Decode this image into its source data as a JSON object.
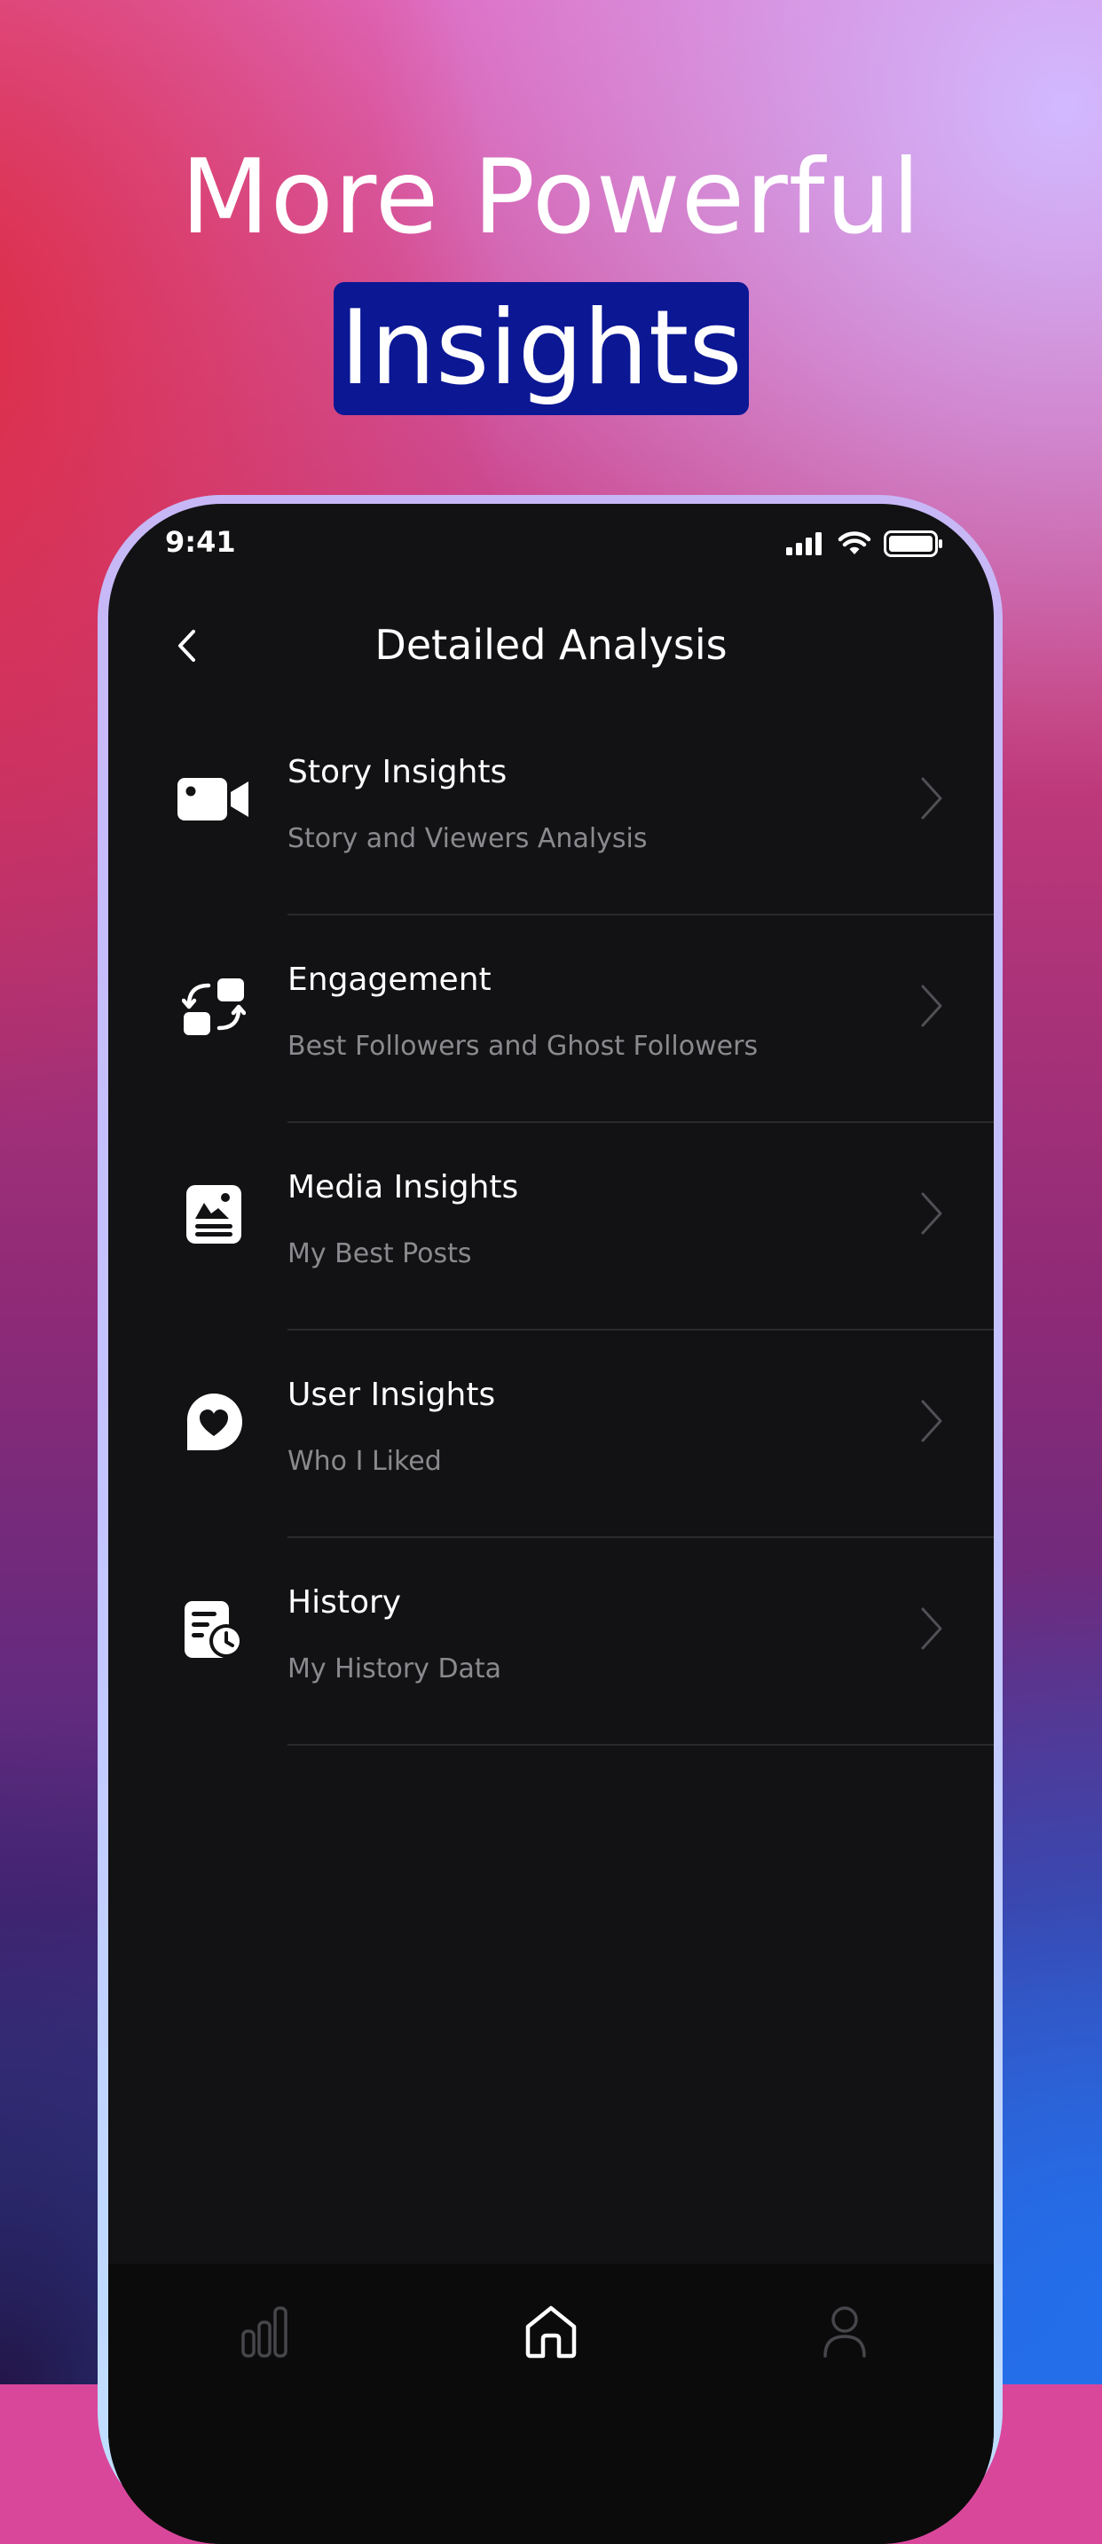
{
  "headline": {
    "line1": "More Powerful",
    "line2": "Insights"
  },
  "colors": {
    "badge": "#0c1794",
    "screen_bg": "#121214",
    "subtitle": "#8a8a8e",
    "divider": "#2a2a2d"
  },
  "status_bar": {
    "time": "9:41",
    "icons": [
      "cellular-signal-icon",
      "wifi-icon",
      "battery-icon"
    ]
  },
  "nav": {
    "title": "Detailed Analysis",
    "back_icon": "chevron-left-icon"
  },
  "items": [
    {
      "title": "Story Insights",
      "subtitle": "Story and Viewers Analysis",
      "icon": "video-camera-icon"
    },
    {
      "title": "Engagement",
      "subtitle": "Best Followers and Ghost Followers",
      "icon": "swap-arrows-icon"
    },
    {
      "title": "Media Insights",
      "subtitle": "My Best Posts",
      "icon": "image-post-icon"
    },
    {
      "title": "User Insights",
      "subtitle": "Who I Liked",
      "icon": "heart-chat-icon"
    },
    {
      "title": "History",
      "subtitle": "My History Data",
      "icon": "history-clock-icon"
    }
  ],
  "tab_bar": {
    "tabs": [
      {
        "icon": "bar-chart-icon",
        "active": false
      },
      {
        "icon": "home-icon",
        "active": true
      },
      {
        "icon": "profile-icon",
        "active": false
      }
    ]
  }
}
